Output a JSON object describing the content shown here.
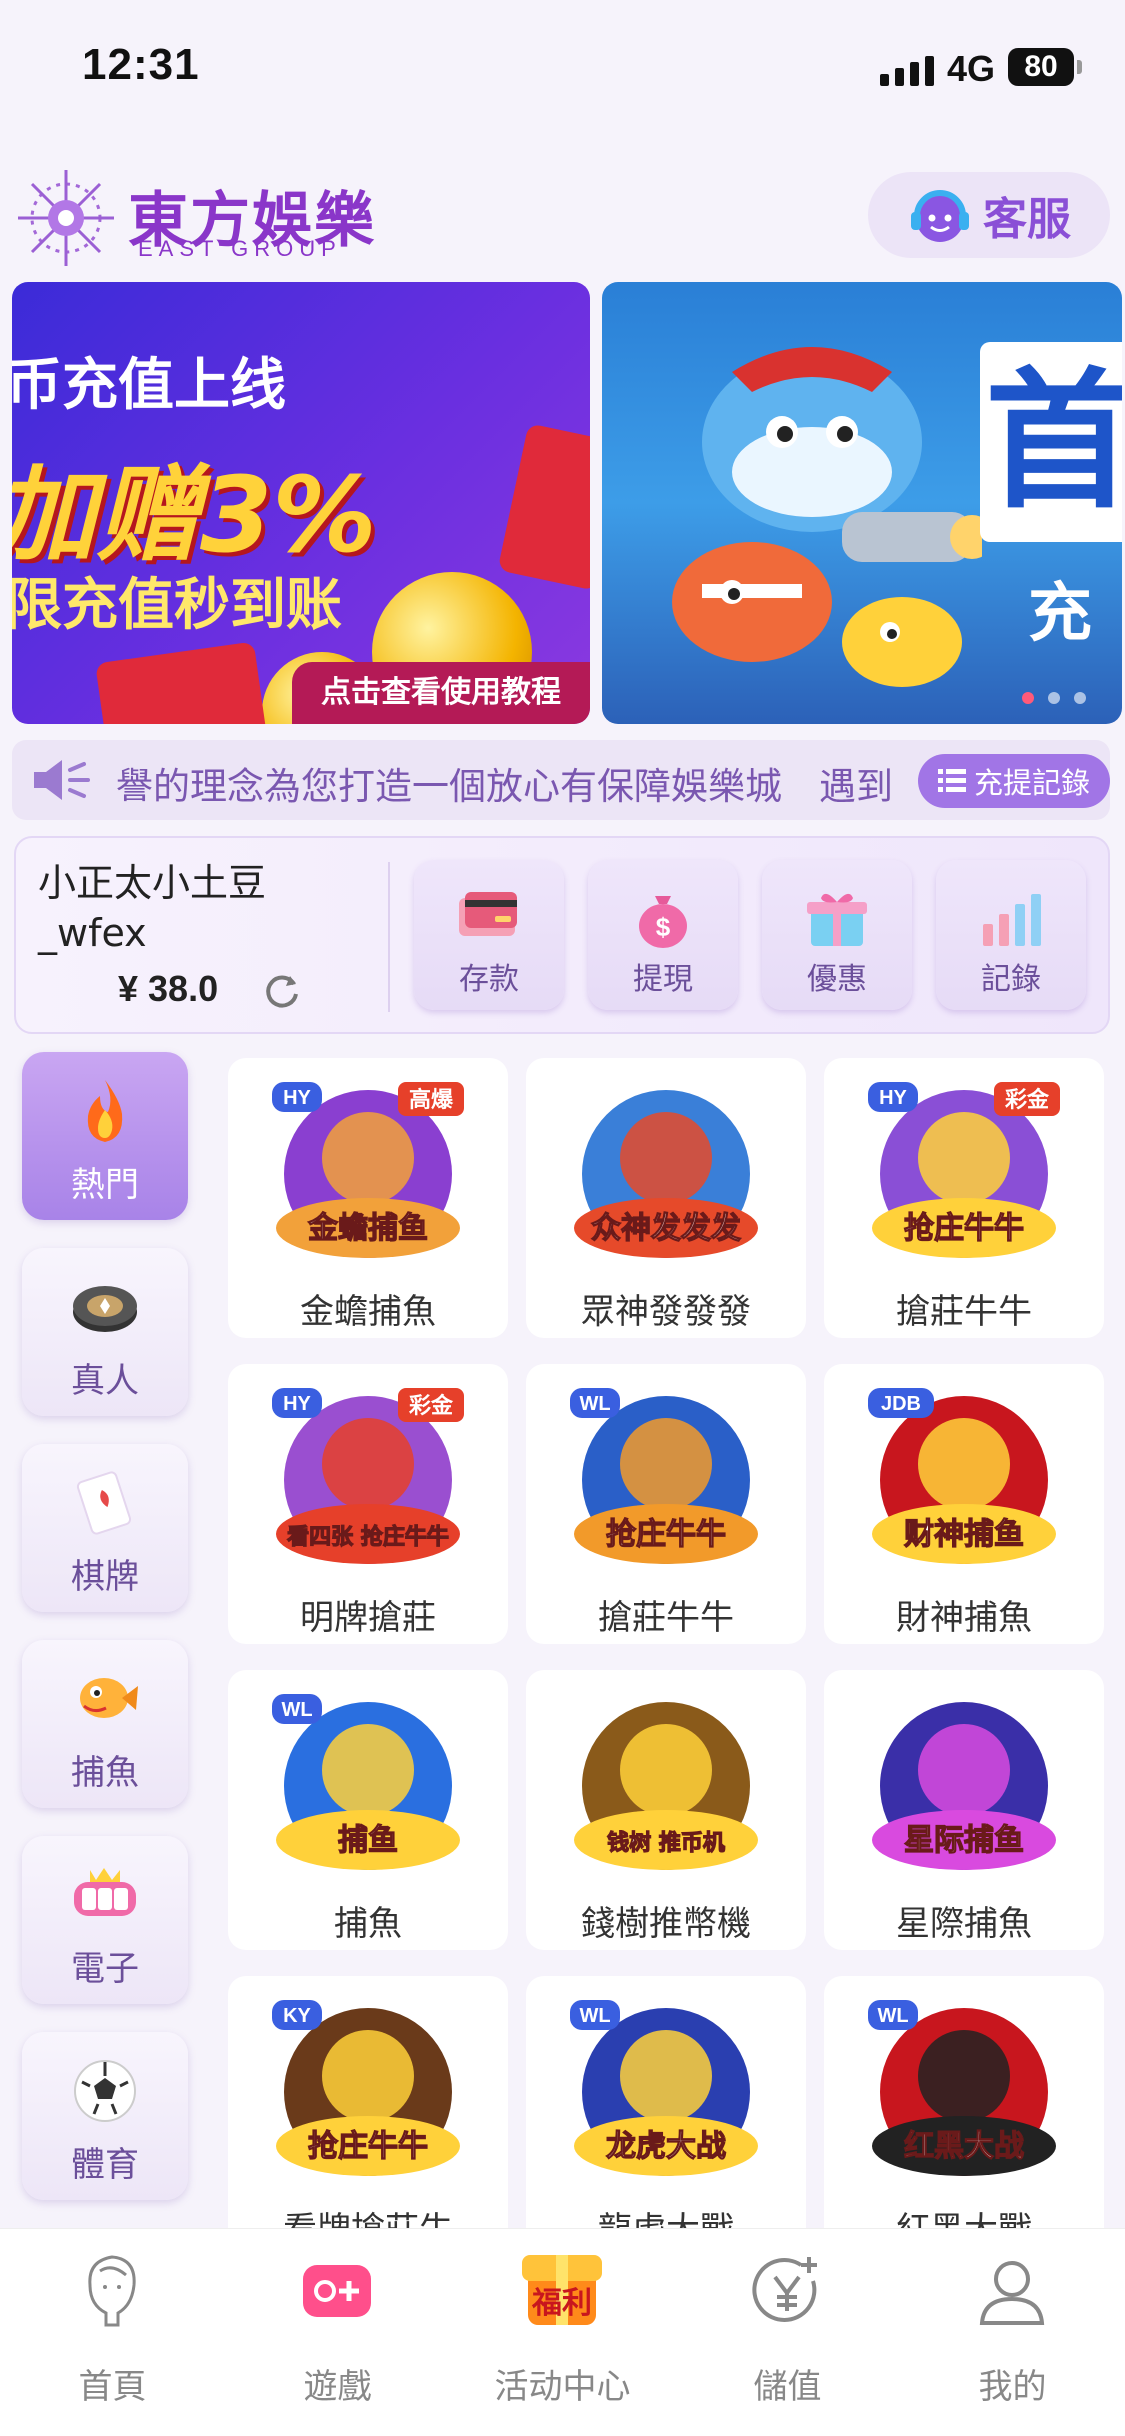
{
  "status_bar": {
    "time": "12:31",
    "network": "4G",
    "battery": "80"
  },
  "header": {
    "brand_cn": "東方娛樂",
    "brand_en": "EAST GROUP",
    "service_label": "客服"
  },
  "banners": {
    "left": {
      "line1": "币充值上线",
      "line2": "加赠3%",
      "line3": "限充值秒到账",
      "tutorial": "点击查看使用教程"
    },
    "right": {
      "big_char": "首",
      "small_char": "充"
    }
  },
  "marquee": {
    "text": "譽的理念為您打造一個放心有保障娛樂城　遇到",
    "record_label": "充提記錄"
  },
  "account": {
    "username": "小正太小土豆_wfex",
    "balance": "¥ 38.0",
    "actions": [
      {
        "label": "存款",
        "icon": "card-icon"
      },
      {
        "label": "提現",
        "icon": "money-bag-icon"
      },
      {
        "label": "優惠",
        "icon": "gift-icon"
      },
      {
        "label": "記錄",
        "icon": "bar-chart-icon"
      }
    ]
  },
  "categories": [
    {
      "label": "熱門",
      "icon": "fire-icon",
      "active": true
    },
    {
      "label": "真人",
      "icon": "poker-chip-icon",
      "active": false
    },
    {
      "label": "棋牌",
      "icon": "playing-card-icon",
      "active": false
    },
    {
      "label": "捕魚",
      "icon": "fish-icon",
      "active": false
    },
    {
      "label": "電子",
      "icon": "slot-machine-icon",
      "active": false
    },
    {
      "label": "體育",
      "icon": "soccer-ball-icon",
      "active": false
    }
  ],
  "games": [
    {
      "name": "金蟾捕魚",
      "badge": "HY",
      "tag": "高爆",
      "art": "金蟾捕鱼"
    },
    {
      "name": "眾神發發發",
      "badge": "",
      "tag": "",
      "art": "众神发发发"
    },
    {
      "name": "搶莊牛牛",
      "badge": "HY",
      "tag": "彩金",
      "art": "抢庄牛牛"
    },
    {
      "name": "明牌搶莊",
      "badge": "HY",
      "tag": "彩金",
      "art": "看四张 抢庄牛牛"
    },
    {
      "name": "搶莊牛牛",
      "badge": "WL",
      "tag": "",
      "art": "抢庄牛牛"
    },
    {
      "name": "財神捕魚",
      "badge": "JDB",
      "tag": "",
      "art": "财神捕鱼"
    },
    {
      "name": "捕魚",
      "badge": "WL",
      "tag": "",
      "art": "捕鱼"
    },
    {
      "name": "錢樹推幣機",
      "badge": "",
      "tag": "",
      "art": "钱树 推币机"
    },
    {
      "name": "星際捕魚",
      "badge": "",
      "tag": "",
      "art": "星际捕鱼"
    },
    {
      "name": "看牌搶莊牛",
      "badge": "KY",
      "tag": "",
      "art": "抢庄牛牛"
    },
    {
      "name": "龍虎大戰",
      "badge": "WL",
      "tag": "",
      "art": "龙虎大战"
    },
    {
      "name": "紅黑大戰",
      "badge": "WL",
      "tag": "",
      "art": "红黑大战"
    }
  ],
  "tabbar": [
    {
      "label": "首頁",
      "icon": "home-lady-icon"
    },
    {
      "label": "遊戲",
      "icon": "gamepad-icon"
    },
    {
      "label": "活动中心",
      "icon": "welfare-chest-icon",
      "badge": "福利"
    },
    {
      "label": "儲值",
      "icon": "yen-plus-icon"
    },
    {
      "label": "我的",
      "icon": "user-icon"
    }
  ],
  "colors": {
    "accent": "#8a36c9",
    "panel": "#ece5f6",
    "active_category": "#a883e8"
  }
}
